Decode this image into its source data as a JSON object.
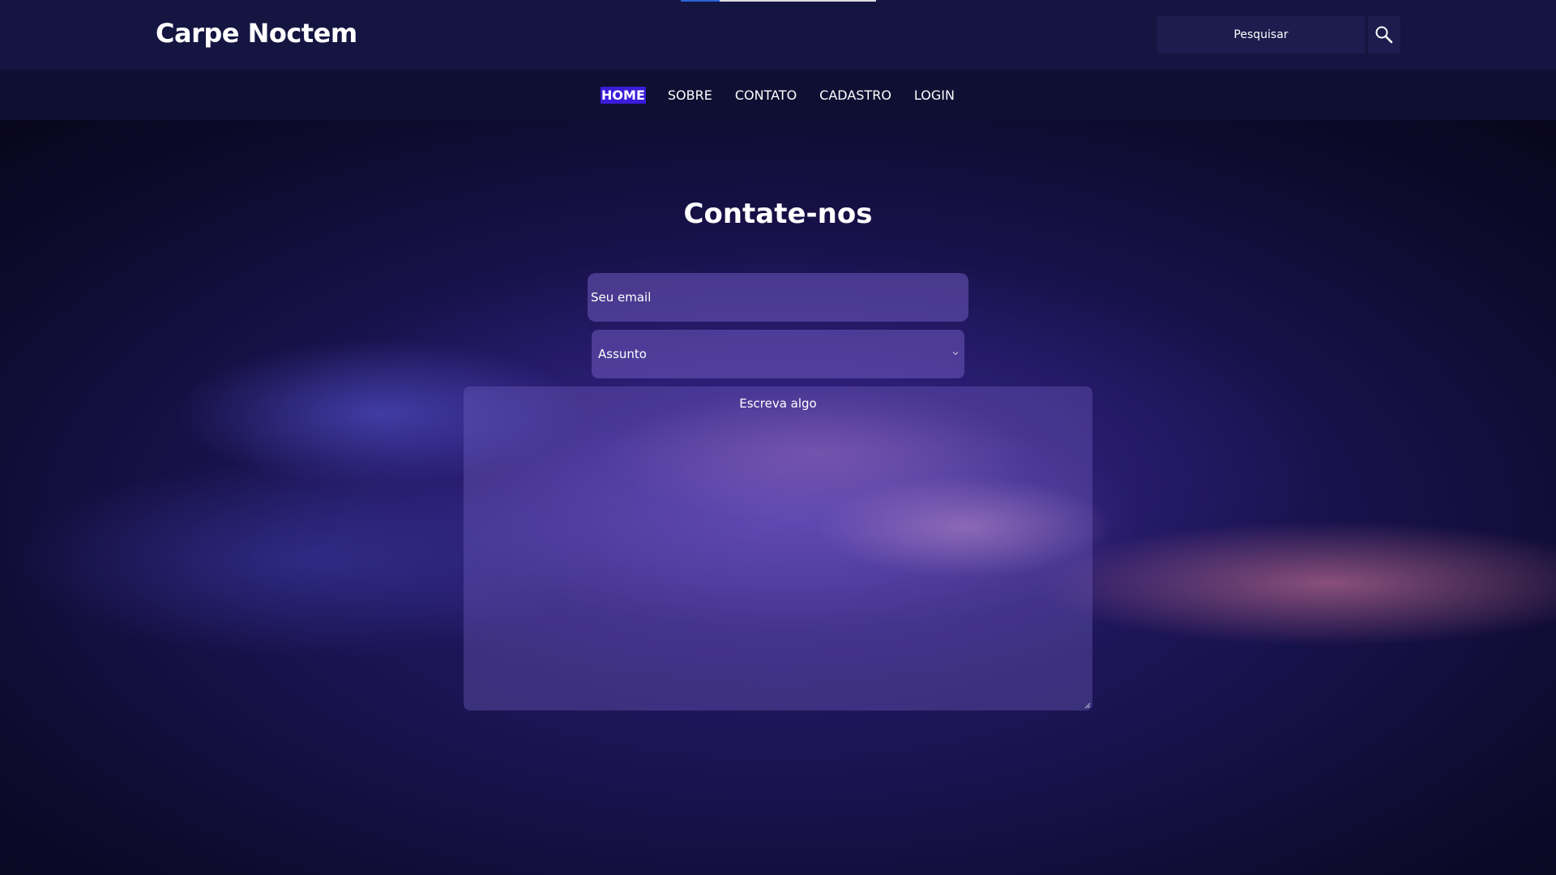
{
  "header": {
    "brand": "Carpe Noctem",
    "search": {
      "placeholder": "Pesquisar",
      "button_icon": "search-icon"
    },
    "loading_progress": 0.2
  },
  "nav": {
    "items": [
      {
        "label": "HOME",
        "active": true
      },
      {
        "label": "SOBRE",
        "active": false
      },
      {
        "label": "CONTATO",
        "active": false
      },
      {
        "label": "CADASTRO",
        "active": false
      },
      {
        "label": "LOGIN",
        "active": false
      }
    ]
  },
  "contact": {
    "title": "Contate-nos",
    "email_placeholder": "Seu email",
    "subject_selected": "Assunto",
    "message_placeholder": "Escreva algo"
  },
  "colors": {
    "header_bg": "#151542",
    "nav_bg": "#0f0f33",
    "active_nav": "#3a1cd9",
    "progress": "#2a63d8"
  }
}
